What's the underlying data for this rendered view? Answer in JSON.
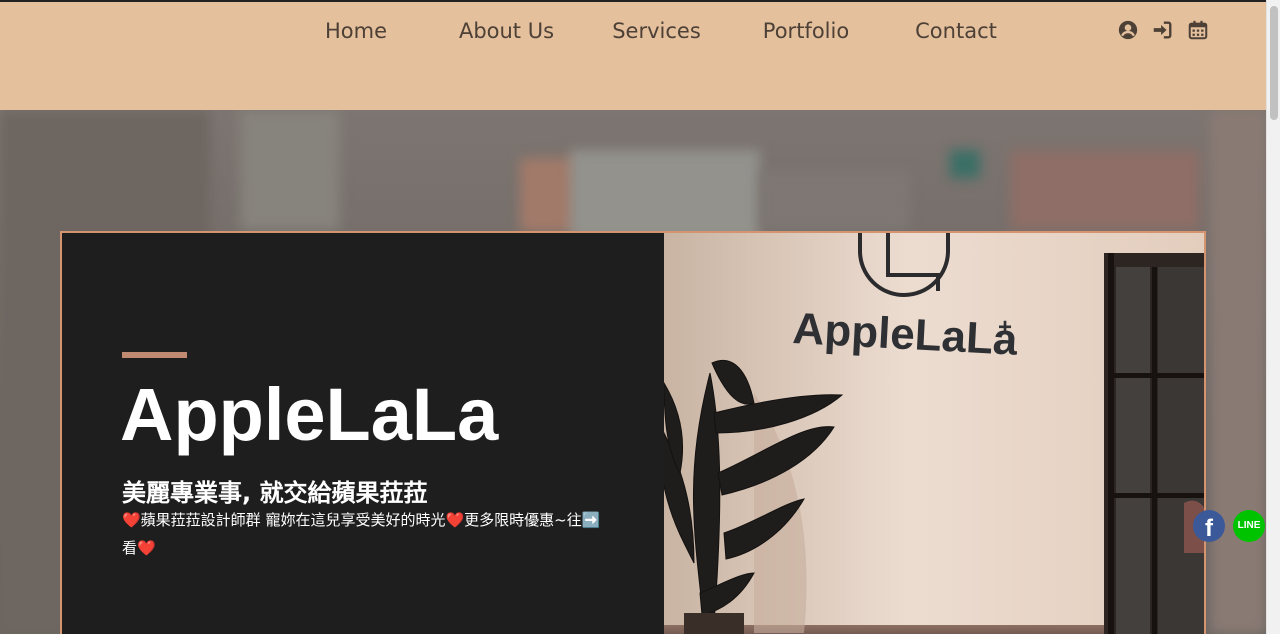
{
  "nav": {
    "links": [
      {
        "label": "Home"
      },
      {
        "label": "About Us"
      },
      {
        "label": "Services"
      },
      {
        "label": "Portfolio"
      },
      {
        "label": "Contact"
      }
    ],
    "icons": [
      "user-circle-icon",
      "sign-in-icon",
      "calendar-icon"
    ]
  },
  "hero": {
    "title": "AppleLaLa",
    "slogan": "美麗專業事, 就交給蘋果菈菈",
    "description": "❤️蘋果菈菈設計師群 寵妳在這兒享受美好的時光❤️更多限時優惠~往➡️看❤️",
    "wall_sign": "AppleLaLa"
  },
  "social": {
    "facebook_glyph": "f",
    "line_label": "LINE"
  },
  "colors": {
    "header_bg": "#e4c09d",
    "card_border": "#d3946f",
    "accent_bar": "#c08a72",
    "card_bg": "#1e1e1e"
  }
}
